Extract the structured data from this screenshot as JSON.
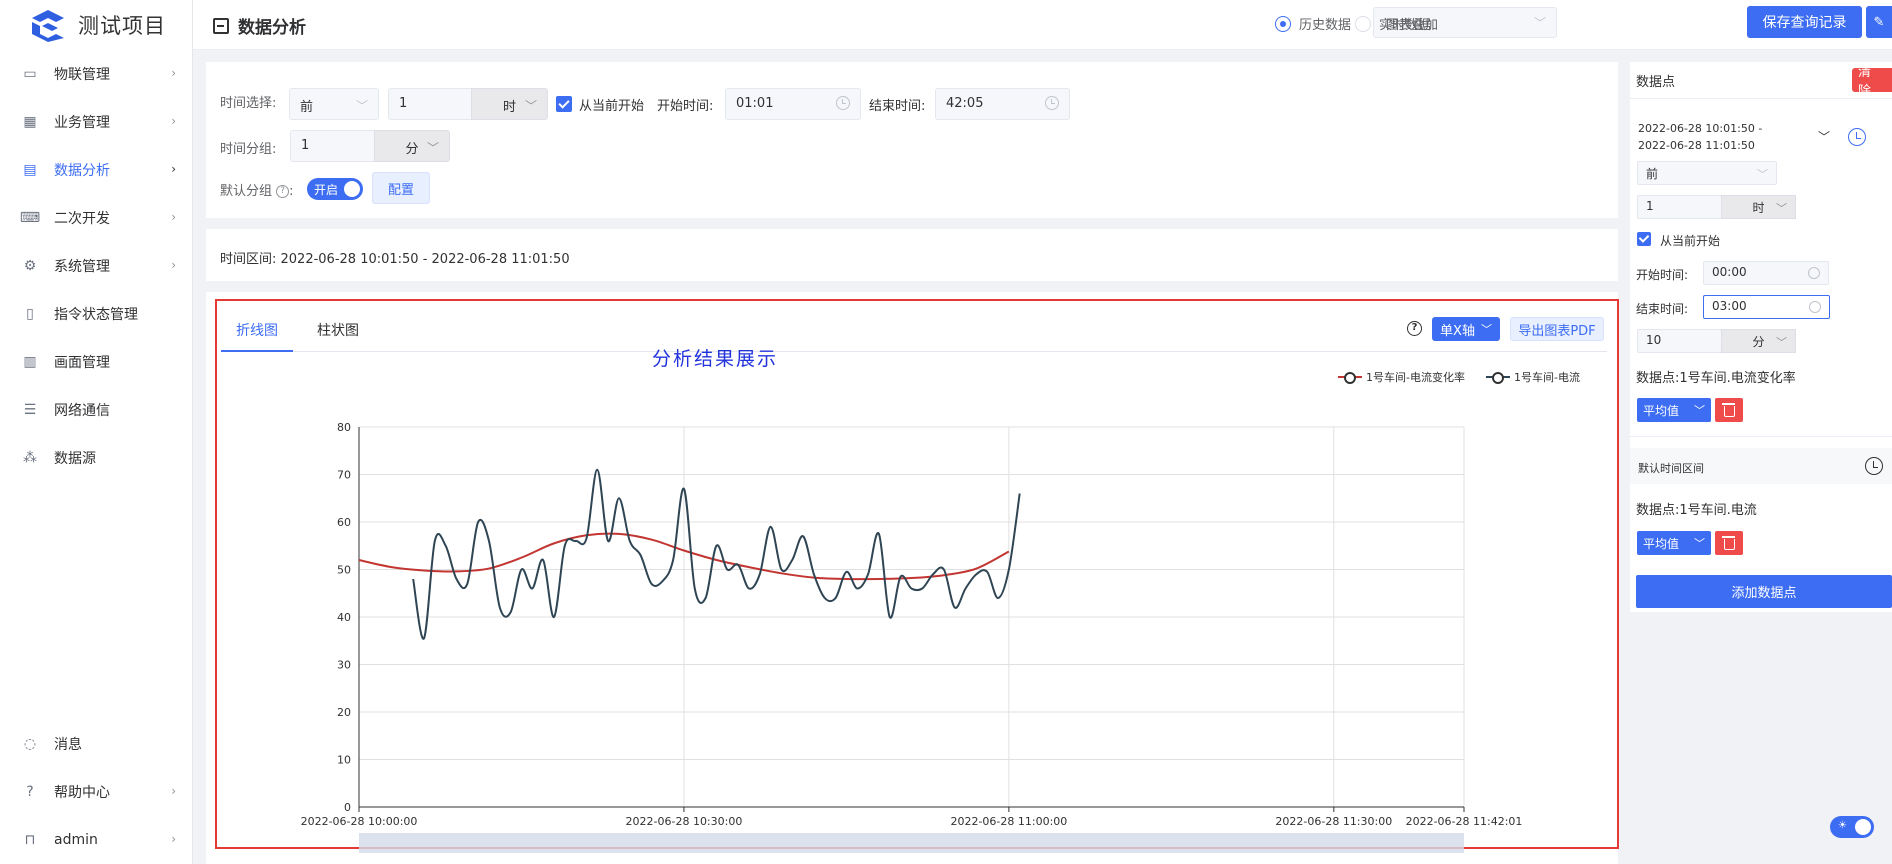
{
  "app": {
    "title": "测试项目"
  },
  "sidebar": {
    "items": [
      {
        "label": "物联管理",
        "icon": "monitor-icon",
        "arrow": true
      },
      {
        "label": "业务管理",
        "icon": "grid-icon",
        "arrow": true
      },
      {
        "label": "数据分析",
        "icon": "analytics-icon",
        "arrow": true,
        "active": true
      },
      {
        "label": "二次开发",
        "icon": "code-icon",
        "arrow": true
      },
      {
        "label": "系统管理",
        "icon": "gear-icon",
        "arrow": true
      },
      {
        "label": "指令状态管理",
        "icon": "clipboard-icon",
        "arrow": false
      },
      {
        "label": "画面管理",
        "icon": "screen-icon",
        "arrow": false
      },
      {
        "label": "网络通信",
        "icon": "network-icon",
        "arrow": false
      },
      {
        "label": "数据源",
        "icon": "datasource-icon",
        "arrow": false
      }
    ],
    "bottom": [
      {
        "label": "消息",
        "icon": "message-icon",
        "arrow": false
      },
      {
        "label": "帮助中心",
        "icon": "help-icon",
        "arrow": true
      },
      {
        "label": "admin",
        "icon": "lock-icon",
        "arrow": true
      }
    ]
  },
  "header": {
    "title": "数据分析",
    "mode_select": "图表叠加",
    "radio_history": "历史数据",
    "radio_realtime": "实时数据",
    "save_button": "保存查询记录"
  },
  "filters": {
    "time_select_label": "时间选择:",
    "direction": "前",
    "amount": "1",
    "unit": "时",
    "from_now_label": "从当前开始",
    "start_label": "开始时间:",
    "start_value": "01:01",
    "end_label": "结束时间:",
    "end_value": "42:05",
    "group_label": "时间分组:",
    "group_amount": "1",
    "group_unit": "分",
    "default_group_label": "默认分组",
    "switch_text": "开启",
    "config_button": "配置"
  },
  "range": {
    "text": "时间区间: 2022-06-28 10:01:50 - 2022-06-28 11:01:50"
  },
  "chart_panel": {
    "tabs": [
      "折线图",
      "柱状图"
    ],
    "overlay_note": "分析结果展示",
    "axis_button": "单X轴",
    "pdf_button": "导出图表PDF",
    "legend": [
      "1号车间-电流变化率",
      "1号车间-电流"
    ]
  },
  "chart_data": {
    "type": "line",
    "x_ticks": [
      "2022-06-28 10:00:00",
      "2022-06-28 10:30:00",
      "2022-06-28 11:00:00",
      "2022-06-28 11:30:00",
      "2022-06-28 11:42:01"
    ],
    "x_tick_minutes": [
      0,
      30,
      60,
      90,
      102.02
    ],
    "y_ticks": [
      0,
      10,
      20,
      30,
      40,
      50,
      60,
      70,
      80
    ],
    "ylim": [
      0,
      80
    ],
    "xlim_minutes": [
      0,
      102.02
    ],
    "grid": true,
    "legend_position": "top-right",
    "series": [
      {
        "name": "1号车间-电流变化率",
        "color": "#c23531",
        "x_minutes": [
          0,
          3,
          6,
          9,
          12,
          15,
          18,
          21,
          24,
          27,
          30,
          33,
          36,
          39,
          42,
          45,
          48,
          51,
          54,
          57,
          60
        ],
        "values": [
          52,
          50.5,
          49.8,
          49.6,
          50.2,
          52.5,
          55.5,
          57.2,
          57.5,
          56.3,
          54,
          52,
          50.5,
          49.2,
          48.3,
          48,
          48,
          48.2,
          48.8,
          50.2,
          53.8
        ]
      },
      {
        "name": "1号车间-电流",
        "color": "#2f4554",
        "x_minutes": [
          5,
          6,
          7,
          8,
          9,
          10,
          11,
          12,
          13,
          14,
          15,
          16,
          17,
          18,
          19,
          20,
          21,
          22,
          23,
          24,
          25,
          26,
          27,
          28,
          29,
          30,
          31,
          32,
          33,
          34,
          35,
          36,
          37,
          38,
          39,
          40,
          41,
          42,
          43,
          44,
          45,
          46,
          47,
          48,
          49,
          50,
          51,
          52,
          53,
          54,
          55,
          56,
          57,
          58,
          59,
          60,
          61
        ],
        "values": [
          48,
          35.5,
          56,
          55,
          48,
          47,
          60,
          56,
          42,
          41,
          50,
          46,
          52,
          40,
          55,
          56,
          56.5,
          71,
          56,
          65,
          56,
          53,
          47,
          47.5,
          52,
          67,
          46,
          44,
          55,
          50,
          51,
          46,
          49,
          59,
          50,
          52,
          57,
          49,
          44,
          44,
          49.5,
          46,
          49,
          57.5,
          40,
          48.5,
          46,
          46,
          49,
          50,
          42,
          46,
          49,
          49.5,
          44,
          50,
          66
        ]
      }
    ]
  },
  "right_panel": {
    "title": "数据点",
    "clear_button": "清 除",
    "range_line1": "2022-06-28 10:01:50 -",
    "range_line2": "2022-06-28 11:01:50",
    "direction": "前",
    "amount": "1",
    "unit": "时",
    "from_now_label": "从当前开始",
    "start_label": "开始时间:",
    "start_value": "00:00",
    "end_label": "结束时间:",
    "end_value": "03:00",
    "group_amount": "10",
    "group_unit": "分",
    "point1_label": "数据点:1号车间.电流变化率",
    "agg1": "平均值",
    "default_range_label": "默认时间区间",
    "point2_label": "数据点:1号车间.电流",
    "agg2": "平均值",
    "add_button": "添加数据点"
  }
}
